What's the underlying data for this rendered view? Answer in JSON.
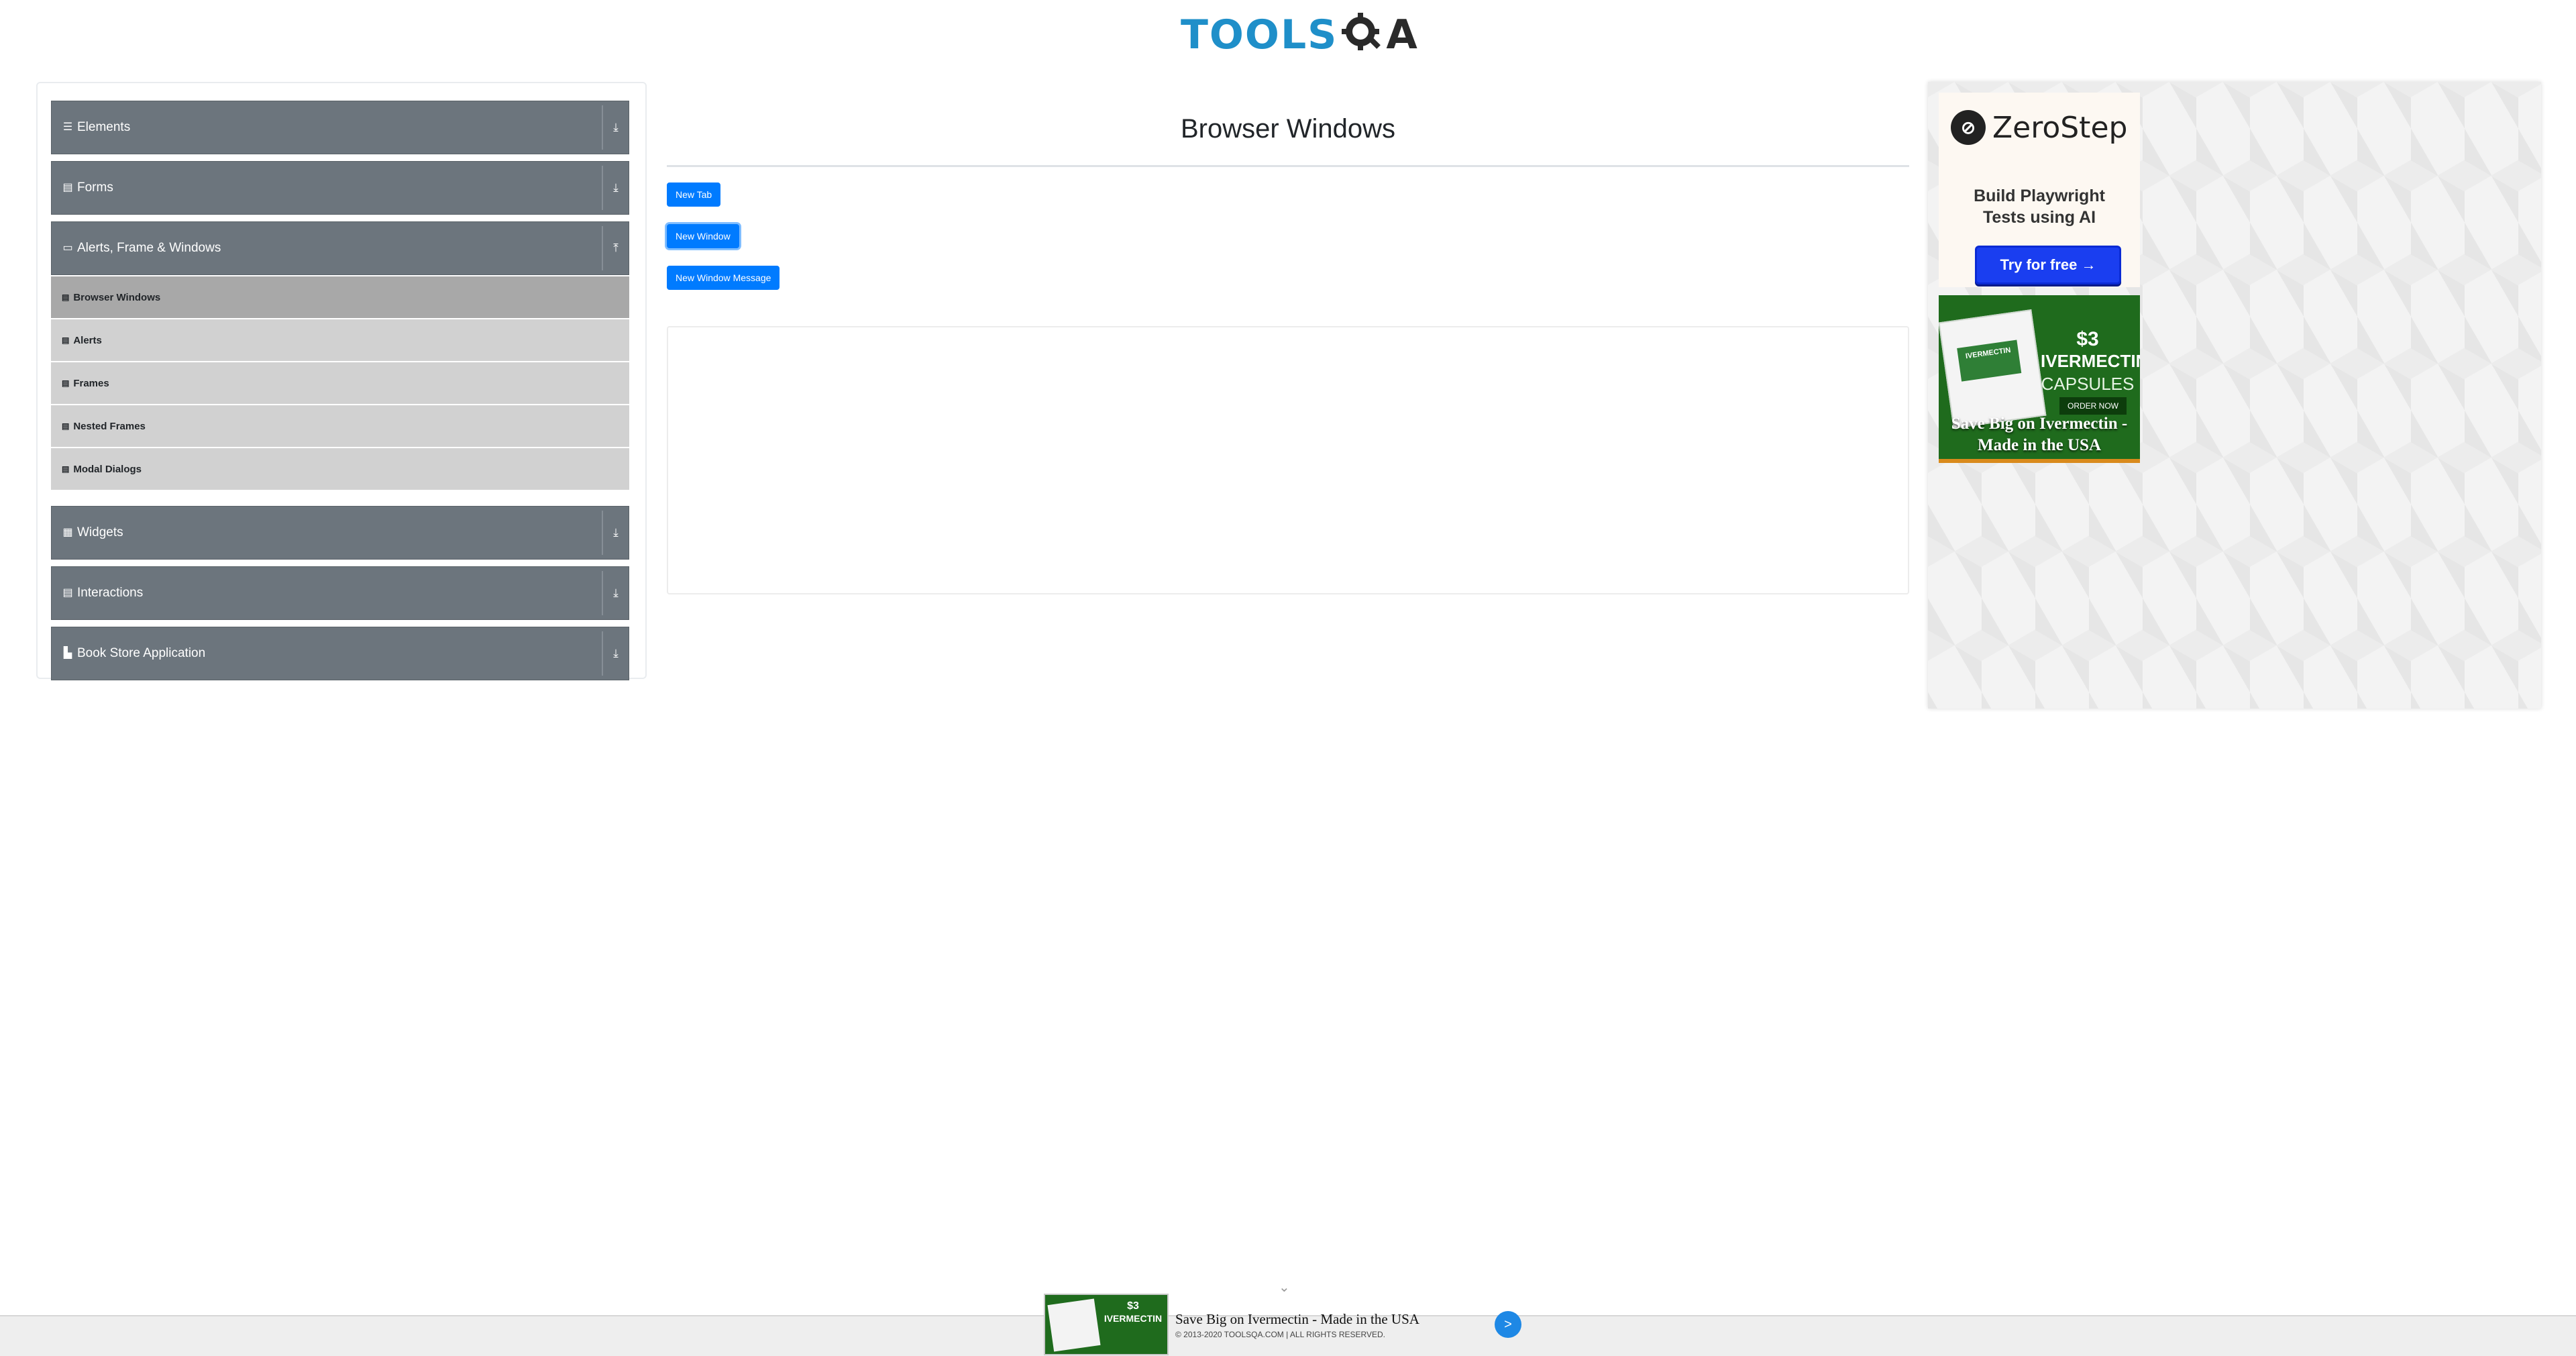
{
  "header": {
    "logo_text": "TOOLS",
    "logo_suffix": "A"
  },
  "sidebar": {
    "groups": [
      {
        "label": "Elements",
        "icon": "menu-icon",
        "expanded": false
      },
      {
        "label": "Forms",
        "icon": "document-icon",
        "expanded": false
      },
      {
        "label": "Alerts, Frame & Windows",
        "icon": "window-icon",
        "expanded": true,
        "items": [
          {
            "label": "Browser Windows",
            "active": true
          },
          {
            "label": "Alerts",
            "active": false
          },
          {
            "label": "Frames",
            "active": false
          },
          {
            "label": "Nested Frames",
            "active": false
          },
          {
            "label": "Modal Dialogs",
            "active": false
          }
        ]
      },
      {
        "label": "Widgets",
        "icon": "grid-icon",
        "expanded": false
      },
      {
        "label": "Interactions",
        "icon": "document-icon",
        "expanded": false
      },
      {
        "label": "Book Store Application",
        "icon": "book-icon",
        "expanded": false
      }
    ]
  },
  "main": {
    "title": "Browser Windows",
    "buttons": {
      "new_tab": "New Tab",
      "new_window": "New Window",
      "new_window_message": "New Window Message"
    }
  },
  "ads": {
    "zerostep": {
      "brand": "ZeroStep",
      "tagline_line1": "Build Playwright",
      "tagline_line2": "Tests using AI",
      "cta": "Try for free →"
    },
    "ivermectin": {
      "price": "$3",
      "product": "IVERMECTIN",
      "form": "CAPSULES",
      "order": "ORDER NOW",
      "headline_line1": "Save Big on Ivermectin -",
      "headline_line2": "Made in the USA"
    }
  },
  "bottom_bar": {
    "thumb_price": "$3",
    "thumb_product": "IVERMECTIN",
    "headline": "Save Big on Ivermectin - Made in the USA",
    "footer_copyright": "© 2013-2020 TOOLSQA.COM | ALL RIGHTS RESERVED.",
    "go_label": ">",
    "chevron": "⌄"
  },
  "colors": {
    "accent_blue": "#007bff",
    "sidebar_header_gray": "#6c757d",
    "logo_blue": "#1f8fc9"
  }
}
